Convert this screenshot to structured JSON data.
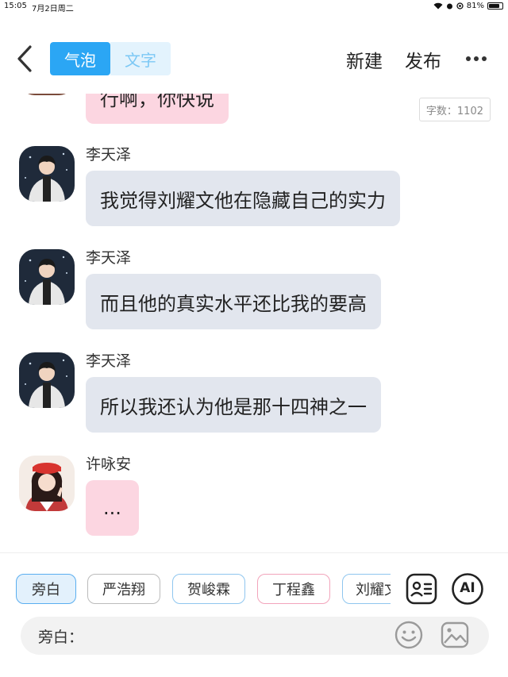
{
  "status_bar": {
    "time": "15:05",
    "date": "7月2日周二",
    "battery": "81%",
    "battery_level": 0.81
  },
  "header": {
    "tabs": [
      {
        "label": "气泡",
        "active": true
      },
      {
        "label": "文字",
        "active": false
      }
    ],
    "new_label": "新建",
    "publish_label": "发布",
    "accent_color": "#2ba6f4"
  },
  "chat": {
    "word_count": "字数：1102",
    "partial_message": {
      "text": "行啊，你快说",
      "bubble": "pink"
    },
    "messages": [
      {
        "sender": "李天泽",
        "text": "我觉得刘耀文他在隐藏自己的实力",
        "bubble": "gray",
        "avatar": "male-avatar"
      },
      {
        "sender": "李天泽",
        "text": "而且他的真实水平还比我的要高",
        "bubble": "gray",
        "avatar": "male-avatar"
      },
      {
        "sender": "李天泽",
        "text": "所以我还认为他是那十四神之一",
        "bubble": "gray",
        "avatar": "male-avatar"
      },
      {
        "sender": "许咏安",
        "text": "...",
        "bubble": "pink",
        "avatar": "female-avatar"
      }
    ]
  },
  "toolbar": {
    "characters": [
      "旁白",
      "严浩翔",
      "贺峻霖",
      "丁程鑫",
      "刘耀文"
    ],
    "selected": "旁白",
    "ai_label": "AI",
    "input_label": "旁白："
  }
}
